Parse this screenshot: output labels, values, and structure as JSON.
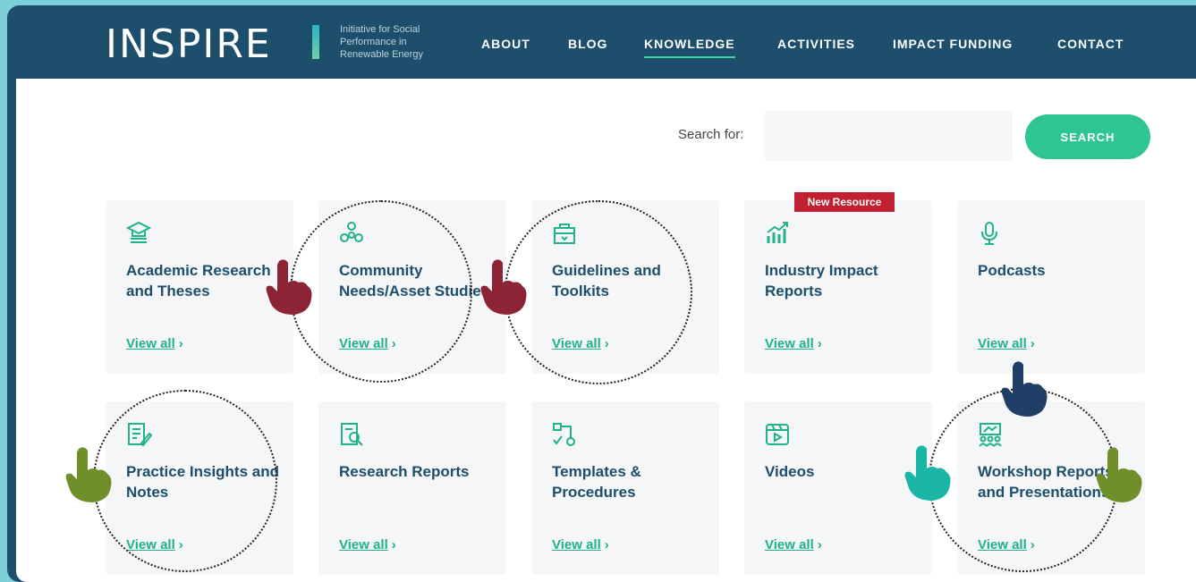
{
  "brand": {
    "name": "INSPIRE",
    "tagline_lines": [
      "Initiative for Social",
      "Performance in",
      "Renewable Energy"
    ]
  },
  "nav": {
    "items": [
      {
        "label": "ABOUT",
        "active": false
      },
      {
        "label": "BLOG",
        "active": false
      },
      {
        "label": "KNOWLEDGE",
        "active": true
      },
      {
        "label": "ACTIVITIES",
        "active": false
      },
      {
        "label": "IMPACT FUNDING",
        "active": false
      },
      {
        "label": "CONTACT",
        "active": false
      }
    ]
  },
  "search": {
    "label": "Search for:",
    "value": "",
    "button": "SEARCH"
  },
  "badge": "New Resource",
  "cards": [
    {
      "title": "Academic Research and Theses",
      "link": "View all",
      "icon": "graduation-cap-icon"
    },
    {
      "title": "Community Needs/Asset Studies",
      "link": "View all",
      "icon": "community-network-icon"
    },
    {
      "title": "Guidelines and Toolkits",
      "link": "View all",
      "icon": "toolbox-icon"
    },
    {
      "title": "Industry Impact Reports",
      "link": "View all",
      "icon": "growth-chart-icon"
    },
    {
      "title": "Podcasts",
      "link": "View all",
      "icon": "microphone-icon"
    },
    {
      "title": "Practice Insights and Notes",
      "link": "View all",
      "icon": "notepad-pen-icon"
    },
    {
      "title": "Research Reports",
      "link": "View all",
      "icon": "document-search-icon"
    },
    {
      "title": "Templates & Procedures",
      "link": "View all",
      "icon": "flow-process-icon"
    },
    {
      "title": "Videos",
      "link": "View all",
      "icon": "video-play-icon"
    },
    {
      "title": "Workshop Reports and Presentations",
      "link": "View all",
      "icon": "presentation-audience-icon"
    }
  ],
  "colors": {
    "header": "#1d4e6b",
    "accent": "#2fc493",
    "card_title": "#1d4e6b",
    "link": "#1fb38a",
    "badge": "#c0202f",
    "hand_red": "#8c2436",
    "hand_green": "#6f8f2a",
    "hand_navy": "#1f3f66",
    "hand_teal": "#1ab5a5"
  }
}
